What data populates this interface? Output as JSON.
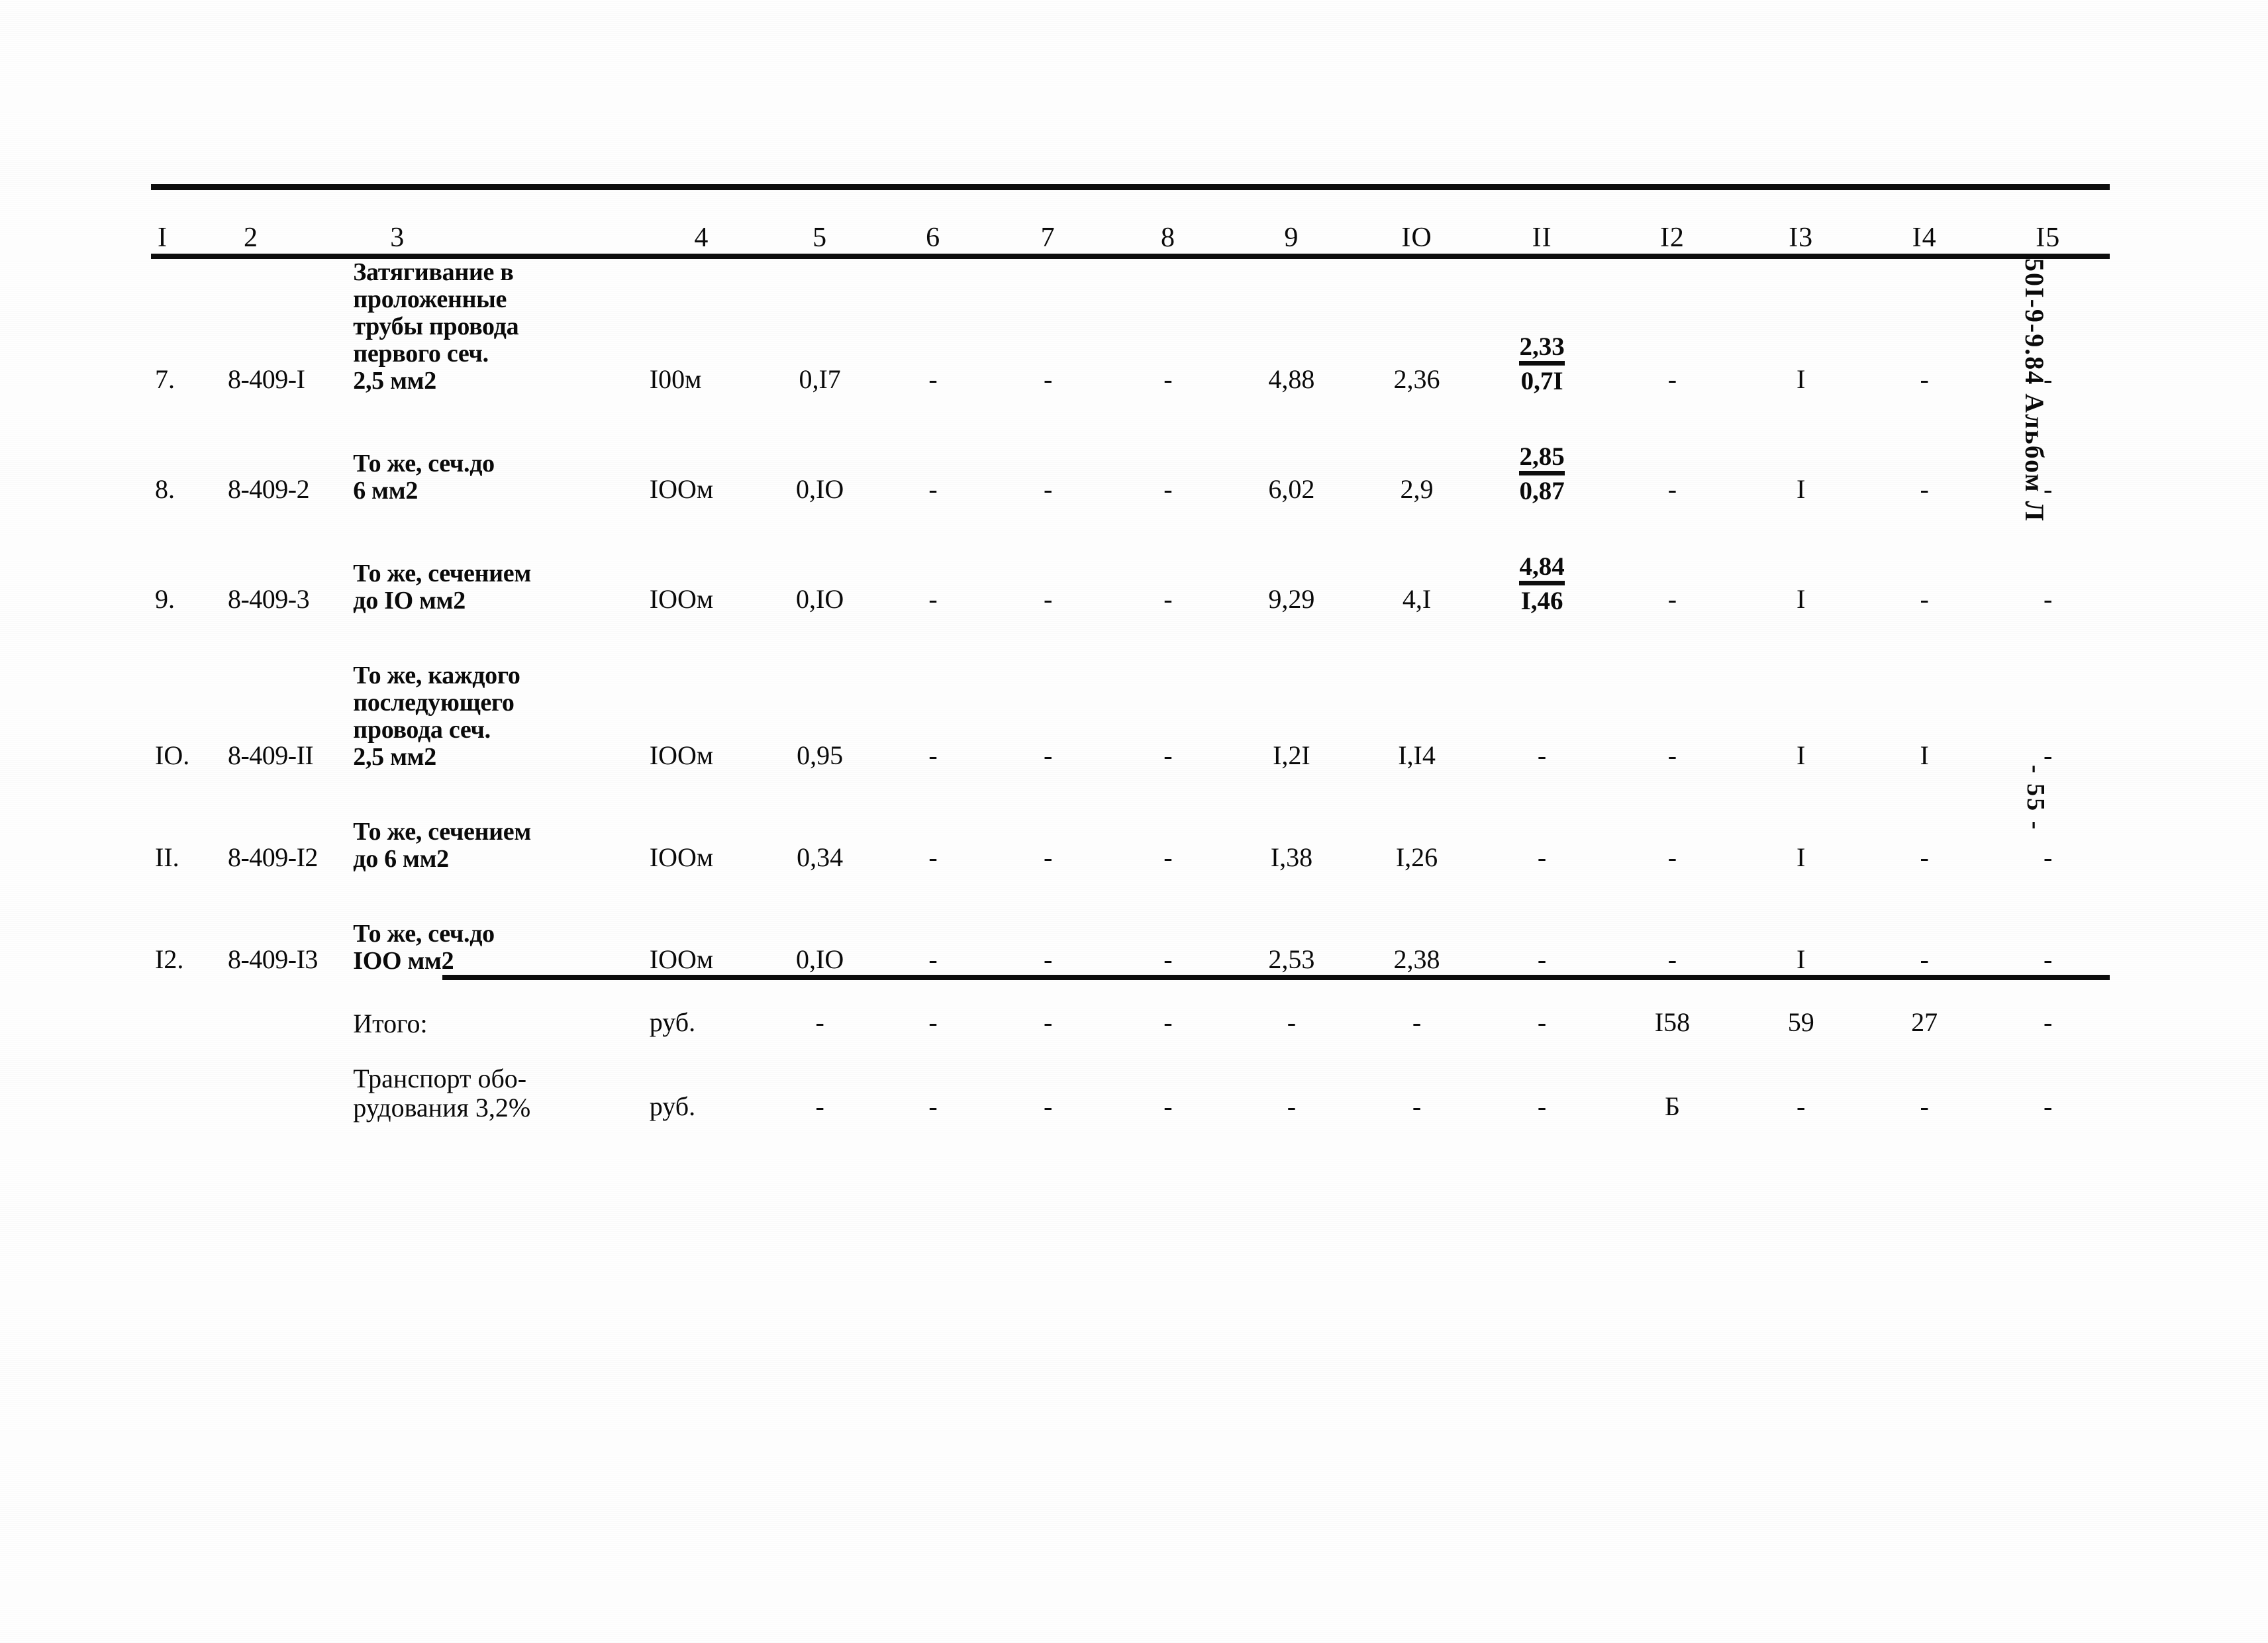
{
  "document": {
    "margin_code": "50I-9-9.84  Альбом Л",
    "page_marker": "- 55 -"
  },
  "table": {
    "column_headers": [
      "I",
      "2",
      "3",
      "4",
      "5",
      "6",
      "7",
      "8",
      "9",
      "IO",
      "II",
      "I2",
      "I3",
      "I4",
      "I5"
    ],
    "rows": [
      {
        "num": "7.",
        "code": "8-409-I",
        "desc_lines": [
          "Затягивание в",
          "проложенные",
          "трубы провода",
          "первого сеч.",
          "2,5 мм2"
        ],
        "unit": "I00м",
        "c5": "0,I7",
        "c6": "-",
        "c7": "-",
        "c8": "-",
        "c9": "4,88",
        "c10": "2,36",
        "c11_top": "2,33",
        "c11_bot": "0,7I",
        "c12": "-",
        "c13": "I",
        "c14": "-",
        "c15": "-"
      },
      {
        "num": "8.",
        "code": "8-409-2",
        "desc_lines": [
          "То же, сеч.до",
          "6 мм2"
        ],
        "unit": "IOOм",
        "c5": "0,IO",
        "c6": "-",
        "c7": "-",
        "c8": "-",
        "c9": "6,02",
        "c10": "2,9",
        "c11_top": "2,85",
        "c11_bot": "0,87",
        "c12": "-",
        "c13": "I",
        "c14": "-",
        "c15": "-"
      },
      {
        "num": "9.",
        "code": "8-409-3",
        "desc_lines": [
          "То же, сечением",
          "до IO мм2"
        ],
        "unit": "IOOм",
        "c5": "0,IO",
        "c6": "-",
        "c7": "-",
        "c8": "-",
        "c9": "9,29",
        "c10": "4,I",
        "c11_top": "4,84",
        "c11_bot": "I,46",
        "c12": "-",
        "c13": "I",
        "c14": "-",
        "c15": "-"
      },
      {
        "num": "IO.",
        "code": "8-409-II",
        "desc_lines": [
          "То же, каждого",
          "последующего",
          "провода сеч.",
          "2,5 мм2"
        ],
        "unit": "IOOм",
        "c5": "0,95",
        "c6": "-",
        "c7": "-",
        "c8": "-",
        "c9": "I,2I",
        "c10": "I,I4",
        "c11_top": "",
        "c11_bot": "",
        "c11_plain": "-",
        "c12": "-",
        "c13": "I",
        "c14": "I",
        "c15": "-"
      },
      {
        "num": "II.",
        "code": "8-409-I2",
        "desc_lines": [
          "То же, сечением",
          "до 6 мм2"
        ],
        "unit": "IOOм",
        "c5": "0,34",
        "c6": "-",
        "c7": "-",
        "c8": "-",
        "c9": "I,38",
        "c10": "I,26",
        "c11_top": "",
        "c11_bot": "",
        "c11_plain": "-",
        "c12": "-",
        "c13": "I",
        "c14": "-",
        "c15": "-"
      },
      {
        "num": "I2.",
        "code": "8-409-I3",
        "desc_lines": [
          "То же, сеч.до",
          "IOO мм2"
        ],
        "unit": "IOOм",
        "c5": "0,IO",
        "c6": "-",
        "c7": "-",
        "c8": "-",
        "c9": "2,53",
        "c10": "2,38",
        "c11_top": "",
        "c11_bot": "",
        "c11_plain": "-",
        "c12": "-",
        "c13": "I",
        "c14": "-",
        "c15": "-"
      }
    ],
    "totals": [
      {
        "desc_lines": [
          "Итого:"
        ],
        "unit": "руб.",
        "c5": "-",
        "c6": "-",
        "c7": "-",
        "c8": "-",
        "c9": "-",
        "c10": "-",
        "c11": "-",
        "c12": "I58",
        "c13": "59",
        "c14": "27",
        "c15": "-"
      },
      {
        "desc_lines": [
          "Транспорт обо-",
          "рудования 3,2%"
        ],
        "unit": "руб.",
        "c5": "-",
        "c6": "-",
        "c7": "-",
        "c8": "-",
        "c9": "-",
        "c10": "-",
        "c11": "-",
        "c12": "Б",
        "c13": "-",
        "c14": "-",
        "c15": "-"
      }
    ]
  }
}
